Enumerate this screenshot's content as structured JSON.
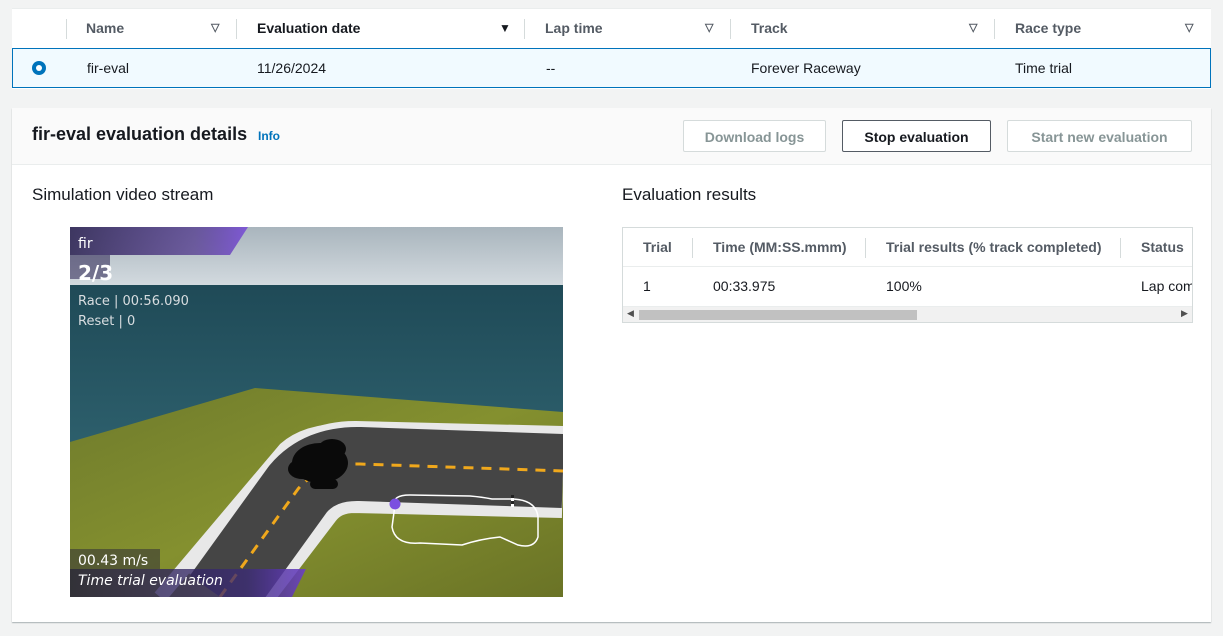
{
  "models_table": {
    "columns": [
      {
        "label": "Name",
        "sort_icon": "triangle-down-outline"
      },
      {
        "label": "Evaluation date",
        "sort_icon": "triangle-down-filled"
      },
      {
        "label": "Lap time",
        "sort_icon": "triangle-down-outline"
      },
      {
        "label": "Track",
        "sort_icon": "triangle-down-outline"
      },
      {
        "label": "Race type",
        "sort_icon": "triangle-down-outline"
      }
    ],
    "row": {
      "selected": true,
      "name": "fir-eval",
      "evaluation_date": "11/26/2024",
      "lap_time": "--",
      "track": "Forever Raceway",
      "race_type": "Time trial"
    }
  },
  "details": {
    "title": "fir-eval evaluation details",
    "info_label": "Info",
    "buttons": {
      "download_logs": "Download logs",
      "stop_evaluation": "Stop evaluation",
      "start_new_evaluation": "Start new evaluation"
    },
    "video_section_title": "Simulation video stream",
    "results_section_title": "Evaluation results"
  },
  "video_overlay": {
    "model_name": "fir",
    "lap_counter": "2/3",
    "race_time": "Race | 00:56.090",
    "reset_count": "Reset | 0",
    "speed": "00.43 m/s",
    "mode": "Time trial evaluation"
  },
  "results_table": {
    "columns": [
      "Trial",
      "Time (MM:SS.mmm)",
      "Trial results (% track completed)",
      "Status"
    ],
    "rows": [
      {
        "trial": "1",
        "time": "00:33.975",
        "result": "100%",
        "status": "Lap complete"
      }
    ]
  },
  "colors": {
    "accent": "#0073bb",
    "selected_row_bg": "#f1faff",
    "overlay_purple": "#6b3fc8"
  }
}
